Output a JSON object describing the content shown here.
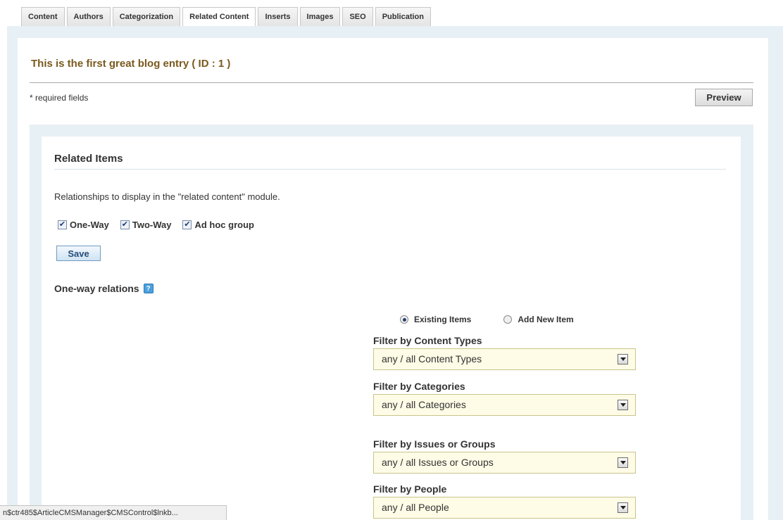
{
  "tabs": [
    {
      "label": "Content"
    },
    {
      "label": "Authors"
    },
    {
      "label": "Categorization"
    },
    {
      "label": "Related Content",
      "active": true
    },
    {
      "label": "Inserts"
    },
    {
      "label": "Images"
    },
    {
      "label": "SEO"
    },
    {
      "label": "Publication"
    }
  ],
  "header": {
    "title": "This is the first great blog entry ( ID : 1 )",
    "required_note": "* required fields",
    "preview_label": "Preview"
  },
  "related": {
    "title": "Related Items",
    "description": "Relationships to display in the \"related content\" module.",
    "checkboxes": [
      {
        "label": "One-Way",
        "checked": true
      },
      {
        "label": "Two-Way",
        "checked": true
      },
      {
        "label": "Ad hoc group",
        "checked": true
      }
    ],
    "save_label": "Save"
  },
  "oneway": {
    "title": "One-way relations",
    "help_icon": "help-icon",
    "radios": [
      {
        "label": "Existing Items",
        "selected": true
      },
      {
        "label": "Add New Item",
        "selected": false
      }
    ],
    "filters": [
      {
        "label": "Filter by Content Types",
        "value": "any / all Content Types"
      },
      {
        "label": "Filter by Categories",
        "value": "any / all Categories"
      },
      {
        "label": "Filter by Issues or Groups",
        "value": "any / all Issues or Groups"
      },
      {
        "label": "Filter by People",
        "value": "any / all People"
      }
    ]
  },
  "status_bar": {
    "text": "n$ctr485$ArticleCMSManager$CMSControl$lnkb..."
  },
  "colors": {
    "title_brown": "#7a5a1e",
    "panel_blue": "#e7f0f5",
    "select_bg": "#fefbe6",
    "save_blue": "#244c7a"
  }
}
